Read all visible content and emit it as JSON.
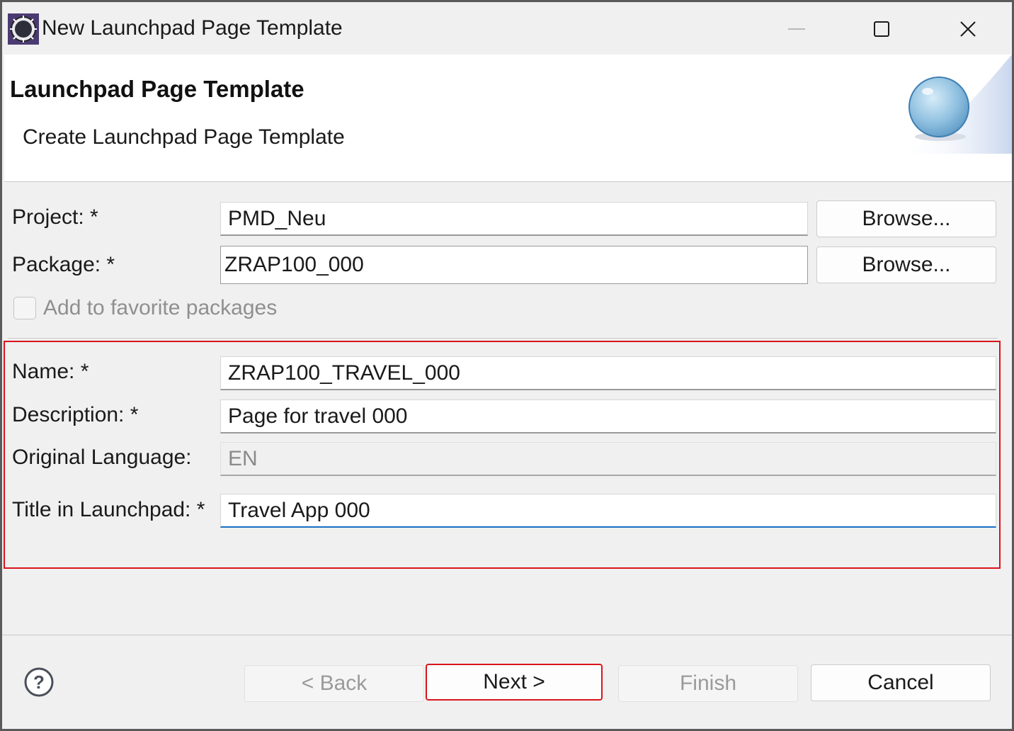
{
  "window": {
    "title": "New Launchpad Page Template",
    "icon": "eclipse-gear-icon"
  },
  "banner": {
    "title": "Launchpad Page Template",
    "subtitle": "Create Launchpad Page Template"
  },
  "form": {
    "project": {
      "label": "Project: *",
      "value": "PMD_Neu",
      "browse_label": "Browse..."
    },
    "package": {
      "label": "Package: *",
      "value": "ZRAP100_000",
      "browse_label": "Browse..."
    },
    "favorite": {
      "label": "Add to favorite packages",
      "checked": false,
      "enabled": false
    },
    "name": {
      "label": "Name: *",
      "value": "ZRAP100_TRAVEL_000"
    },
    "description": {
      "label": "Description: *",
      "value": "Page for travel 000"
    },
    "original_language": {
      "label": "Original Language:",
      "value": "EN"
    },
    "title_in_launchpad": {
      "label": "Title in Launchpad: *",
      "value": "Travel App 000"
    }
  },
  "footer": {
    "help_icon": "question-mark-circle-icon",
    "back_label": "< Back",
    "next_label": "Next >",
    "finish_label": "Finish",
    "cancel_label": "Cancel"
  },
  "colors": {
    "highlight": "#d9141b",
    "focus": "#1a6fc4"
  }
}
